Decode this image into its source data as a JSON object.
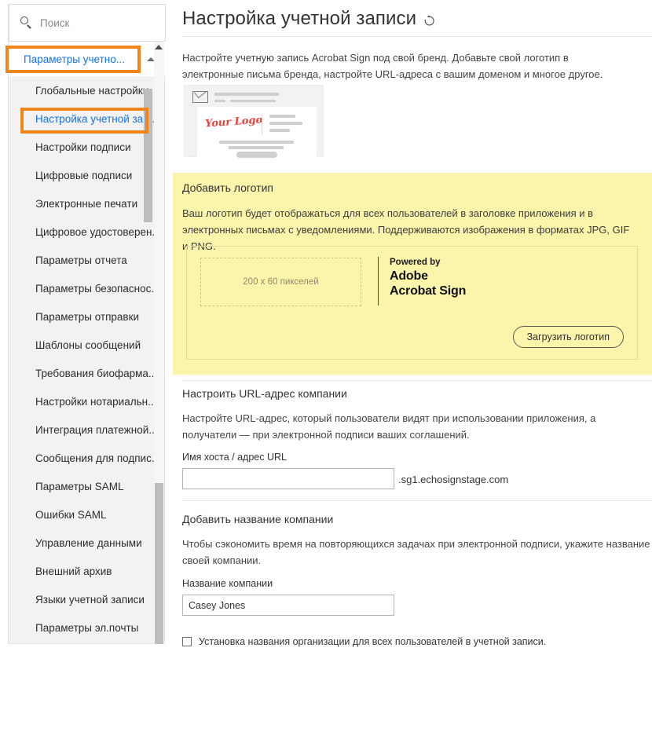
{
  "sidebar": {
    "search": {
      "placeholder": "Поиск",
      "icon": "search-icon"
    },
    "group": {
      "label": "Параметры учетно...",
      "chevron": "chevron-down-icon"
    },
    "items": [
      {
        "label": "Глобальные настройки",
        "active": false
      },
      {
        "label": "Настройка учетной зап...",
        "active": true
      },
      {
        "label": "Настройки подписи",
        "active": false
      },
      {
        "label": "Цифровые подписи",
        "active": false
      },
      {
        "label": "Электронные печати",
        "active": false
      },
      {
        "label": "Цифровое удостоверен...",
        "active": false
      },
      {
        "label": "Параметры отчета",
        "active": false
      },
      {
        "label": "Параметры безопаснос...",
        "active": false
      },
      {
        "label": "Параметры отправки",
        "active": false
      },
      {
        "label": "Шаблоны сообщений",
        "active": false
      },
      {
        "label": "Требования биофарма...",
        "active": false
      },
      {
        "label": "Настройки нотариальн...",
        "active": false
      },
      {
        "label": "Интеграция платежной...",
        "active": false
      },
      {
        "label": "Сообщения для подпис...",
        "active": false
      },
      {
        "label": "Параметры SAML",
        "active": false
      },
      {
        "label": "Ошибки SAML",
        "active": false
      },
      {
        "label": "Управление данными",
        "active": false
      },
      {
        "label": "Внешний архив",
        "active": false
      },
      {
        "label": "Языки учетной записи",
        "active": false
      },
      {
        "label": "Параметры эл.почты",
        "active": false
      }
    ]
  },
  "main": {
    "title": "Настройка учетной записи",
    "refresh_icon": "refresh-icon",
    "intro": "Настройте учетную запись Acrobat Sign под свой бренд. Добавьте свой логотип в электронные письма бренда, настройте URL-адреса с вашим доменом и многое другое.",
    "preview": {
      "logo_text": "Your Logo",
      "envelope_icon": "envelope-icon"
    },
    "logo_section": {
      "title": "Добавить логотип",
      "description": "Ваш логотип будет отображаться для всех пользователей в заголовке приложения и в электронных письмах с уведомлениями. Поддерживаются изображения в форматах JPG, GIF и PNG.",
      "dropzone_text": "200 x 60 пикселей",
      "powered_by": "Powered by",
      "brand_line1": "Adobe",
      "brand_line2": "Acrobat Sign",
      "upload_button": "Загрузить логотип"
    },
    "url_section": {
      "title": "Настроить URL-адрес компании",
      "description": "Настройте URL-адрес, который пользователи видят при использовании приложения, а получатели — при электронной подписи ваших соглашений.",
      "field_label": "Имя хоста / адрес URL",
      "field_value": "",
      "suffix": ".sg1.echosignstage.com"
    },
    "company_section": {
      "title": "Добавить название компании",
      "description": "Чтобы сэкономить время на повторяющихся задачах при электронной подписи, укажите название своей компании.",
      "field_label": "Название компании",
      "field_value": "Casey Jones",
      "checkbox_label": "Установка названия организации для всех пользователей в учетной записи.",
      "checkbox_checked": false
    }
  },
  "colors": {
    "highlight": "#f0851a",
    "accent_link": "#1473e6",
    "logo_panel_bg": "#fbf4ab",
    "logo_red": "#e8413a"
  }
}
